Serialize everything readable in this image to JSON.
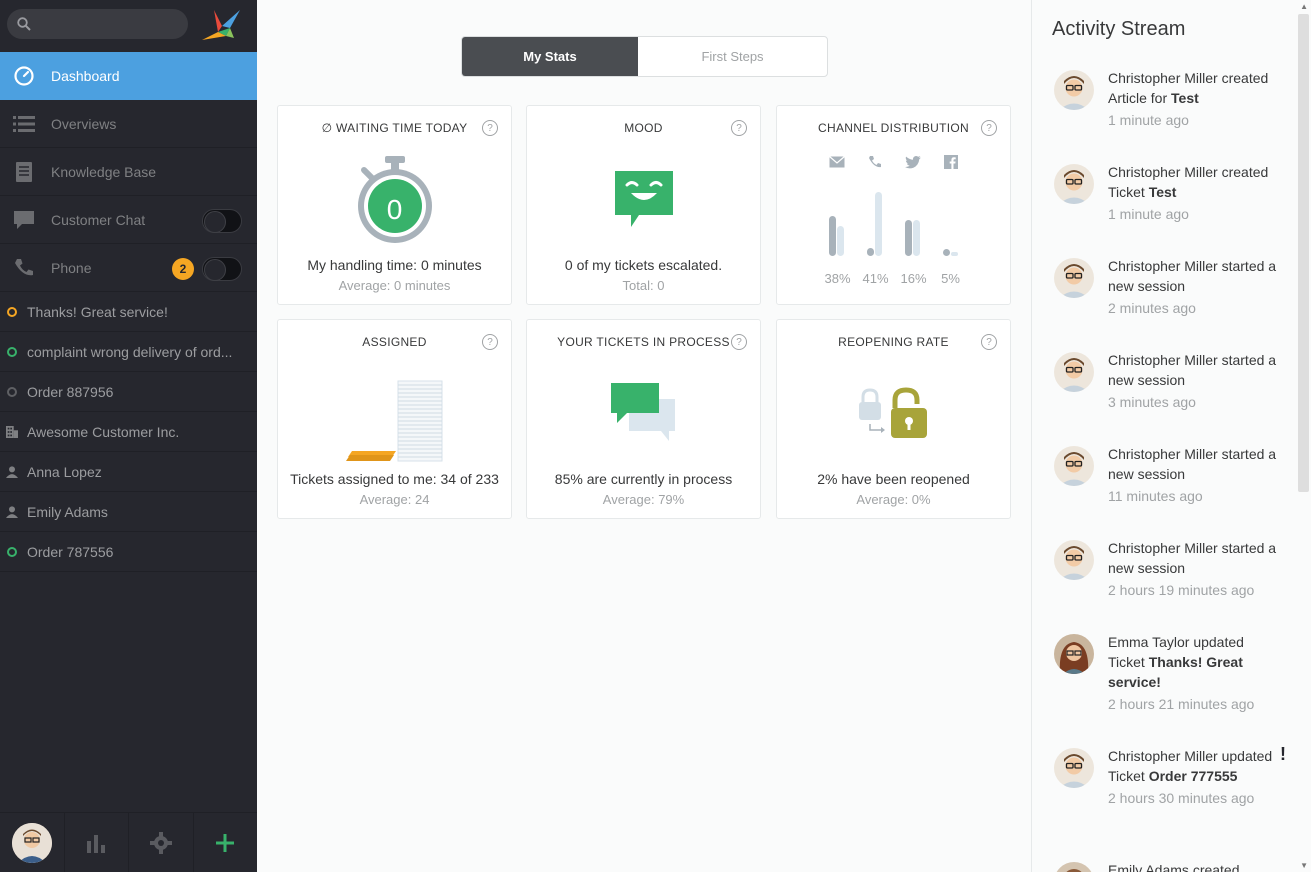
{
  "search": {
    "placeholder": ""
  },
  "nav": [
    {
      "label": "Dashboard",
      "icon": "dashboard-icon",
      "active": true
    },
    {
      "label": "Overviews",
      "icon": "overviews-icon"
    },
    {
      "label": "Knowledge Base",
      "icon": "knowledge-base-icon"
    },
    {
      "label": "Customer Chat",
      "icon": "chat-icon",
      "toggle": true
    },
    {
      "label": "Phone",
      "icon": "phone-icon",
      "toggle": true,
      "badge": "2"
    }
  ],
  "tasks": [
    {
      "label": "Thanks! Great service!",
      "icon": "ticket-open-icon",
      "color": "#f5a623"
    },
    {
      "label": "complaint wrong delivery of ord...",
      "icon": "ticket-open-icon",
      "color": "#38b26b"
    },
    {
      "label": "Order 887956",
      "icon": "ticket-closed-icon",
      "color": "#5f6064"
    },
    {
      "label": "Awesome Customer Inc.",
      "icon": "organization-icon"
    },
    {
      "label": "Anna Lopez",
      "icon": "user-icon"
    },
    {
      "label": "Emily Adams",
      "icon": "user-icon"
    },
    {
      "label": "Order 787556",
      "icon": "ticket-open-icon",
      "color": "#38b26b"
    }
  ],
  "tabs": {
    "my_stats": "My Stats",
    "first_steps": "First Steps"
  },
  "cards": {
    "waiting": {
      "title": "∅ WAITING TIME TODAY",
      "value": "0",
      "main": "My handling time: 0 minutes",
      "sub": "Average: 0 minutes"
    },
    "mood": {
      "title": "MOOD",
      "main": "0 of my tickets escalated.",
      "sub": "Total: 0"
    },
    "channel": {
      "title": "CHANNEL DISTRIBUTION",
      "channels": [
        {
          "icon": "email-icon",
          "pct": "38%",
          "a": 0.6,
          "b": 0.45
        },
        {
          "icon": "phone-icon",
          "pct": "41%",
          "a": 0.12,
          "b": 0.97
        },
        {
          "icon": "twitter-icon",
          "pct": "16%",
          "a": 0.55,
          "b": 0.55
        },
        {
          "icon": "facebook-icon",
          "pct": "5%",
          "a": 0.1,
          "b": 0.05
        }
      ]
    },
    "assigned": {
      "title": "ASSIGNED",
      "main": "Tickets assigned to me: 34 of 233",
      "sub": "Average: 24"
    },
    "in_process": {
      "title": "YOUR TICKETS IN PROCESS",
      "main": "85% are currently in process",
      "sub": "Average: 79%"
    },
    "reopening": {
      "title": "REOPENING RATE",
      "main": "2% have been reopened",
      "sub": "Average: 0%"
    }
  },
  "help_label": "?",
  "activity": {
    "title": "Activity Stream",
    "items": [
      {
        "user": "Christopher Miller",
        "action": "created Article for",
        "object": "Test",
        "time": "1 minute ago",
        "avatar": "male"
      },
      {
        "user": "Christopher Miller",
        "action": "created Ticket",
        "object": "Test",
        "time": "1 minute ago",
        "avatar": "male"
      },
      {
        "user": "Christopher Miller",
        "action": "started a new session",
        "object": "",
        "time": "2 minutes ago",
        "avatar": "male"
      },
      {
        "user": "Christopher Miller",
        "action": "started a new session",
        "object": "",
        "time": "3 minutes ago",
        "avatar": "male"
      },
      {
        "user": "Christopher Miller",
        "action": "started a new session",
        "object": "",
        "time": "11 minutes ago",
        "avatar": "male"
      },
      {
        "user": "Christopher Miller",
        "action": "started a new session",
        "object": "",
        "time": "2 hours 19 minutes ago",
        "avatar": "male"
      },
      {
        "user": "Emma Taylor",
        "action": "updated Ticket",
        "object": "Thanks! Great service!",
        "time": "2 hours 21 minutes ago",
        "avatar": "female"
      },
      {
        "user": "Christopher Miller",
        "action": "updated Ticket",
        "object": "Order 777555",
        "time": "2 hours 30 minutes ago",
        "avatar": "male",
        "alert": "!"
      },
      {
        "user": "Emily Adams",
        "action": "created",
        "object": "",
        "time": "",
        "avatar": "female2"
      }
    ]
  },
  "colors": {
    "accent": "#4ca0e0",
    "green": "#38b26b",
    "olive": "#a8a43a",
    "yellow": "#f5a623",
    "sidebar": "#26272e"
  }
}
